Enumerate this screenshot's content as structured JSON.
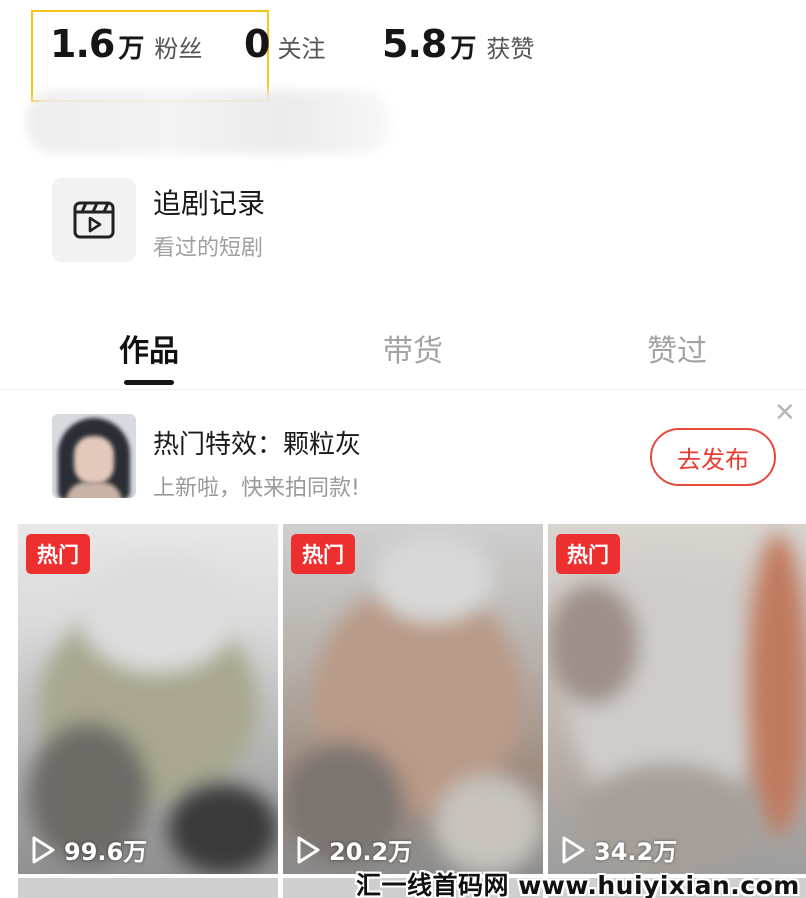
{
  "stats": {
    "fans": {
      "value": "1.6",
      "unit": "万",
      "label": "粉丝"
    },
    "following": {
      "value": "0",
      "label": "关注"
    },
    "likes": {
      "value": "5.8",
      "unit": "万",
      "label": "获赞"
    }
  },
  "drama_record": {
    "icon": "video-clapper-icon",
    "title": "追剧记录",
    "subtitle": "看过的短剧"
  },
  "tabs": [
    {
      "label": "作品",
      "active": true
    },
    {
      "label": "带货",
      "active": false
    },
    {
      "label": "赞过",
      "active": false
    }
  ],
  "promo": {
    "title": "热门特效：颗粒灰",
    "subtitle": "上新啦，快来拍同款!",
    "button_label": "去发布",
    "close_icon": "close-icon"
  },
  "videos": [
    {
      "badge": "热门",
      "play_count": "99.6万"
    },
    {
      "badge": "热门",
      "play_count": "20.2万"
    },
    {
      "badge": "热门",
      "play_count": "34.2万"
    }
  ],
  "watermark": "汇一线首码网 www.huiyixian.com",
  "colors": {
    "highlight_box": "#f5c518",
    "hot_badge": "#ee2f2f",
    "accent_red": "#e53d33"
  }
}
